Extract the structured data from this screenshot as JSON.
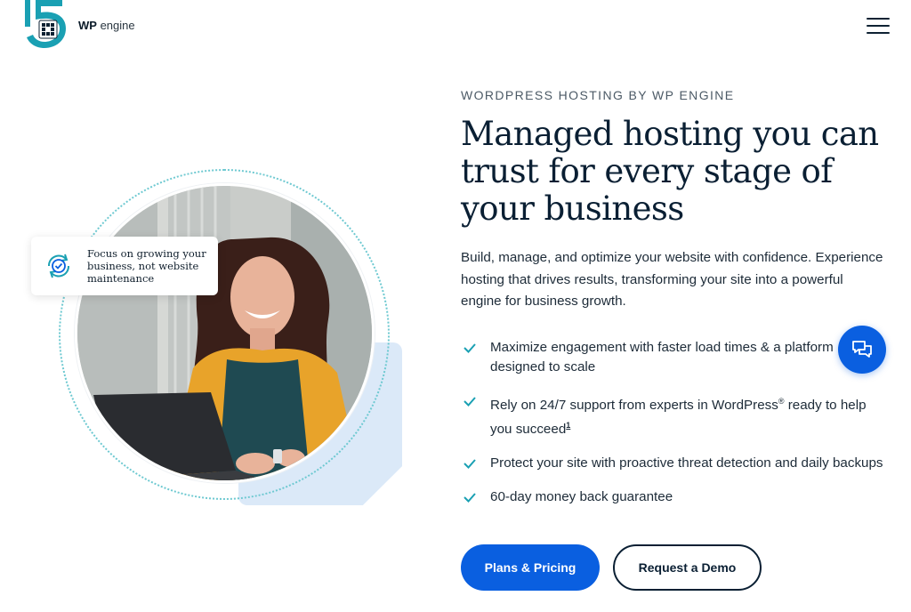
{
  "brand": {
    "anniversary_number": "15",
    "logo_prefix": "WP",
    "logo_suffix": "engine",
    "accent": "#0a5fe0",
    "teal": "#1aa0b3",
    "menu_icon": "hamburger-menu-icon"
  },
  "hero": {
    "eyebrow": "WORDPRESS HOSTING BY WP ENGINE",
    "headline": "Managed hosting you can trust for every stage of your business",
    "lead": "Build, manage, and optimize your website with confidence. Experience hosting that drives results, transforming your site into a powerful engine for business growth.",
    "callout": {
      "icon": "sync-check-icon",
      "text": "Focus on growing your business, not website maintenance"
    },
    "benefits": [
      {
        "text": "Maximize engagement with faster load times & a platform designed to scale"
      },
      {
        "text_before": "Rely on 24/7 support from experts in WordPress",
        "registered": "®",
        "text_after": " ready to help you succeed",
        "footnote": "1"
      },
      {
        "text": "Protect your site with proactive threat detection and daily backups"
      },
      {
        "text": "60-day money back guarantee"
      }
    ],
    "cta_primary": "Plans & Pricing",
    "cta_secondary": "Request a Demo"
  },
  "chat": {
    "icon": "chat-bubbles-icon"
  }
}
